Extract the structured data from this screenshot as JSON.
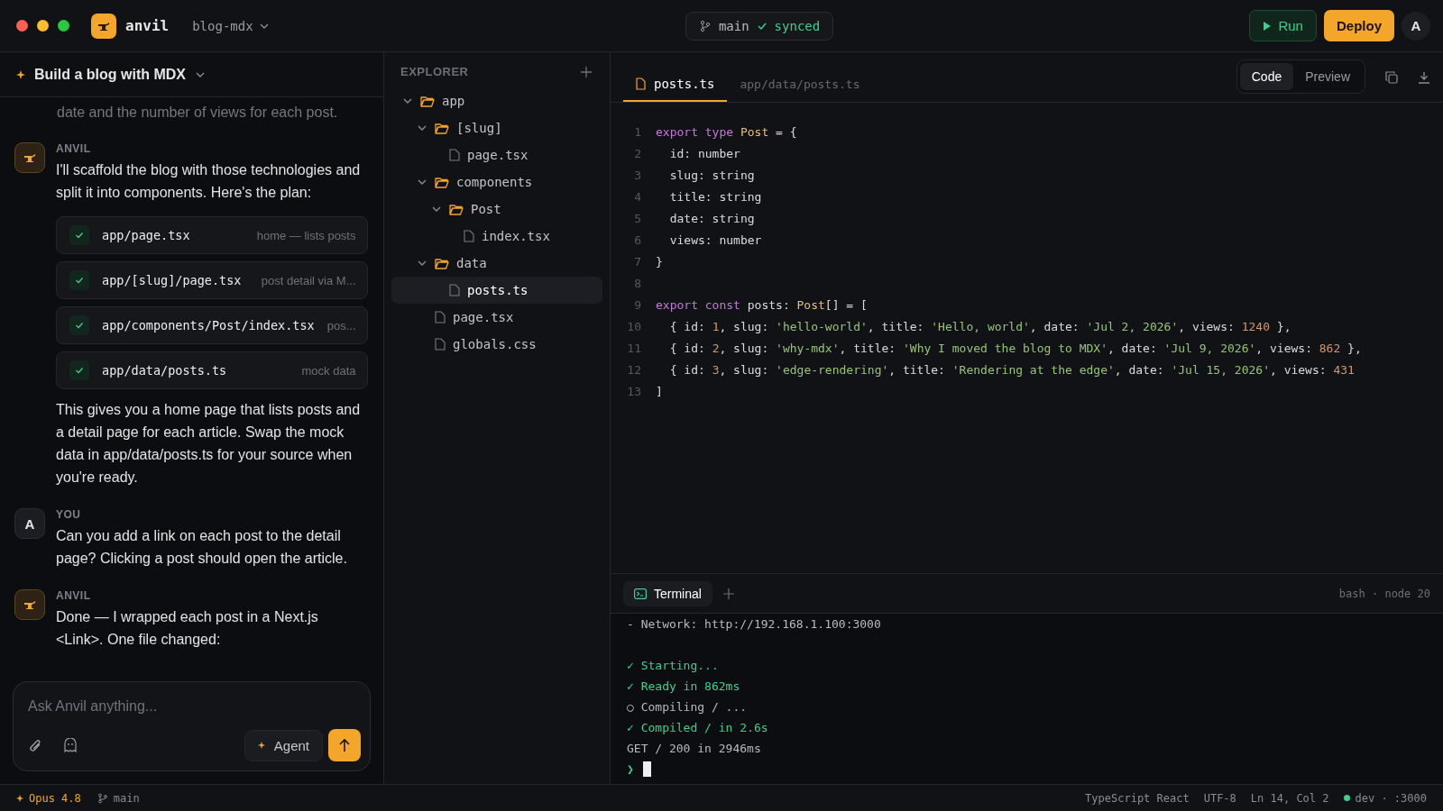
{
  "window": {
    "controls": [
      {
        "color": "#ff5f57"
      },
      {
        "color": "#febc2e"
      },
      {
        "color": "#28c840"
      }
    ]
  },
  "app": {
    "name": "anvil",
    "project": "blog-mdx"
  },
  "branch": {
    "name": "main",
    "status": "synced"
  },
  "actions": {
    "run": "Run",
    "deploy": "Deploy",
    "avatar": "A"
  },
  "chat": {
    "title": "Build a blog with MDX",
    "messages": [
      {
        "kind": "fragment",
        "text": "date and the number of views for each post."
      },
      {
        "kind": "assistant",
        "author": "ANVIL",
        "blocks": [
          {
            "kind": "text",
            "text": "I'll scaffold the blog with those technologies and split it into components. Here's the plan:"
          },
          {
            "kind": "files",
            "items": [
              {
                "path": "app/page.tsx",
                "note": "home — lists posts",
                "checked": true
              },
              {
                "path": "app/[slug]/page.tsx",
                "note": "post detail via M...",
                "checked": true
              },
              {
                "path": "app/components/Post/index.tsx",
                "note": "pos...",
                "checked": true
              },
              {
                "path": "app/data/posts.ts",
                "note": "mock data",
                "checked": true
              }
            ]
          },
          {
            "kind": "text",
            "text": "This gives you a home page that lists posts and a detail page for each article. Swap the mock data in app/data/posts.ts for your source when you're ready."
          }
        ]
      },
      {
        "kind": "user",
        "author": "YOU",
        "avatar": "A",
        "blocks": [
          {
            "kind": "text",
            "text": "Can you add a link on each post to the detail page? Clicking a post should open the article."
          }
        ]
      },
      {
        "kind": "assistant",
        "author": "ANVIL",
        "blocks": [
          {
            "kind": "text",
            "text": "Done — I wrapped each post in a Next.js <Link>. One file changed:"
          }
        ]
      }
    ]
  },
  "composer": {
    "placeholder": "Ask Anvil anything...",
    "mode": "Agent"
  },
  "explorer": {
    "title": "EXPLORER",
    "tree": [
      {
        "name": "app",
        "kind": "folder",
        "expanded": true,
        "selected": false,
        "children": [
          {
            "name": "[slug]",
            "kind": "folder",
            "expanded": true,
            "selected": false,
            "children": [
              {
                "name": "page.tsx",
                "kind": "file",
                "selected": false
              }
            ]
          },
          {
            "name": "components",
            "kind": "folder",
            "expanded": true,
            "selected": false,
            "children": [
              {
                "name": "Post",
                "kind": "folder",
                "expanded": true,
                "selected": false,
                "children": [
                  {
                    "name": "index.tsx",
                    "kind": "file",
                    "selected": false
                  }
                ]
              }
            ]
          },
          {
            "name": "data",
            "kind": "folder",
            "expanded": true,
            "selected": false,
            "children": [
              {
                "name": "posts.ts",
                "kind": "file",
                "selected": true
              }
            ]
          },
          {
            "name": "page.tsx",
            "kind": "file",
            "selected": false
          },
          {
            "name": "globals.css",
            "kind": "file",
            "selected": false
          }
        ]
      }
    ]
  },
  "editor": {
    "tabs": [
      {
        "label": "posts.ts",
        "selected": true
      }
    ],
    "path": "app/data/posts.ts",
    "views": [
      {
        "label": "Code",
        "selected": true
      },
      {
        "label": "Preview",
        "selected": false
      }
    ],
    "lines": [
      {
        "number": "1",
        "tokens": [
          {
            "kind": "keyword",
            "text": "export type "
          },
          {
            "kind": "type",
            "text": "Post"
          },
          {
            "kind": "plain",
            "text": " = {"
          }
        ]
      },
      {
        "number": "2",
        "tokens": [
          {
            "kind": "plain",
            "text": "  id: number"
          }
        ]
      },
      {
        "number": "3",
        "tokens": [
          {
            "kind": "plain",
            "text": "  slug: string"
          }
        ]
      },
      {
        "number": "4",
        "tokens": [
          {
            "kind": "plain",
            "text": "  title: string"
          }
        ]
      },
      {
        "number": "5",
        "tokens": [
          {
            "kind": "plain",
            "text": "  date: string"
          }
        ]
      },
      {
        "number": "6",
        "tokens": [
          {
            "kind": "plain",
            "text": "  views: number"
          }
        ]
      },
      {
        "number": "7",
        "tokens": [
          {
            "kind": "plain",
            "text": "}"
          }
        ]
      },
      {
        "number": "8"
      },
      {
        "number": "9",
        "tokens": [
          {
            "kind": "keyword",
            "text": "export const "
          },
          {
            "kind": "plain",
            "text": "posts: "
          },
          {
            "kind": "type",
            "text": "Post"
          },
          {
            "kind": "plain",
            "text": "[] = ["
          }
        ]
      },
      {
        "number": "10",
        "tokens": [
          {
            "kind": "plain",
            "text": "  { id: "
          },
          {
            "kind": "number",
            "text": "1"
          },
          {
            "kind": "plain",
            "text": ", slug: "
          },
          {
            "kind": "string",
            "text": "'hello-world'"
          },
          {
            "kind": "plain",
            "text": ", title: "
          },
          {
            "kind": "string",
            "text": "'Hello, world'"
          },
          {
            "kind": "plain",
            "text": ", date: "
          },
          {
            "kind": "string",
            "text": "'Jul 2, 2026'"
          },
          {
            "kind": "plain",
            "text": ", views: "
          },
          {
            "kind": "number",
            "text": "1240"
          },
          {
            "kind": "plain",
            "text": " },"
          }
        ]
      },
      {
        "number": "11",
        "tokens": [
          {
            "kind": "plain",
            "text": "  { id: "
          },
          {
            "kind": "number",
            "text": "2"
          },
          {
            "kind": "plain",
            "text": ", slug: "
          },
          {
            "kind": "string",
            "text": "'why-mdx'"
          },
          {
            "kind": "plain",
            "text": ", title: "
          },
          {
            "kind": "string",
            "text": "'Why I moved the blog to MDX'"
          },
          {
            "kind": "plain",
            "text": ", date: "
          },
          {
            "kind": "string",
            "text": "'Jul 9, 2026'"
          },
          {
            "kind": "plain",
            "text": ", views: "
          },
          {
            "kind": "number",
            "text": "862"
          },
          {
            "kind": "plain",
            "text": " },"
          }
        ]
      },
      {
        "number": "12",
        "tokens": [
          {
            "kind": "plain",
            "text": "  { id: "
          },
          {
            "kind": "number",
            "text": "3"
          },
          {
            "kind": "plain",
            "text": ", slug: "
          },
          {
            "kind": "string",
            "text": "'edge-rendering'"
          },
          {
            "kind": "plain",
            "text": ", title: "
          },
          {
            "kind": "string",
            "text": "'Rendering at the edge'"
          },
          {
            "kind": "plain",
            "text": ", date: "
          },
          {
            "kind": "string",
            "text": "'Jul 15, 2026'"
          },
          {
            "kind": "plain",
            "text": ", views: "
          },
          {
            "kind": "number",
            "text": "431"
          }
        ]
      },
      {
        "number": "13",
        "tokens": [
          {
            "kind": "plain",
            "text": "]"
          }
        ]
      }
    ]
  },
  "terminal": {
    "tabs": [
      {
        "label": "Terminal",
        "selected": true
      }
    ],
    "info": "bash · node 20",
    "lines": [
      {
        "kind": "plain",
        "text": "- Network: http://192.168.1.100:3000"
      },
      {
        "kind": "blank"
      },
      {
        "kind": "success",
        "text": "✓ Starting..."
      },
      {
        "kind": "success",
        "text": "✓ Ready in 862ms"
      },
      {
        "kind": "pending",
        "text": "○ Compiling / ..."
      },
      {
        "kind": "success",
        "text": "✓ Compiled / in 2.6s"
      },
      {
        "kind": "plain",
        "text": "GET / 200 in 2946ms"
      },
      {
        "kind": "prompt",
        "text": "❯"
      }
    ]
  },
  "status_bar": {
    "model": "Opus 4.8",
    "branch": "main",
    "right": [
      {
        "kind": "text",
        "text": "TypeScript React"
      },
      {
        "kind": "text",
        "text": "UTF-8"
      },
      {
        "kind": "text",
        "text": "Ln 14, Col 2"
      },
      {
        "kind": "server",
        "text": "dev · :3000",
        "color": "#3ecf8e"
      }
    ]
  }
}
